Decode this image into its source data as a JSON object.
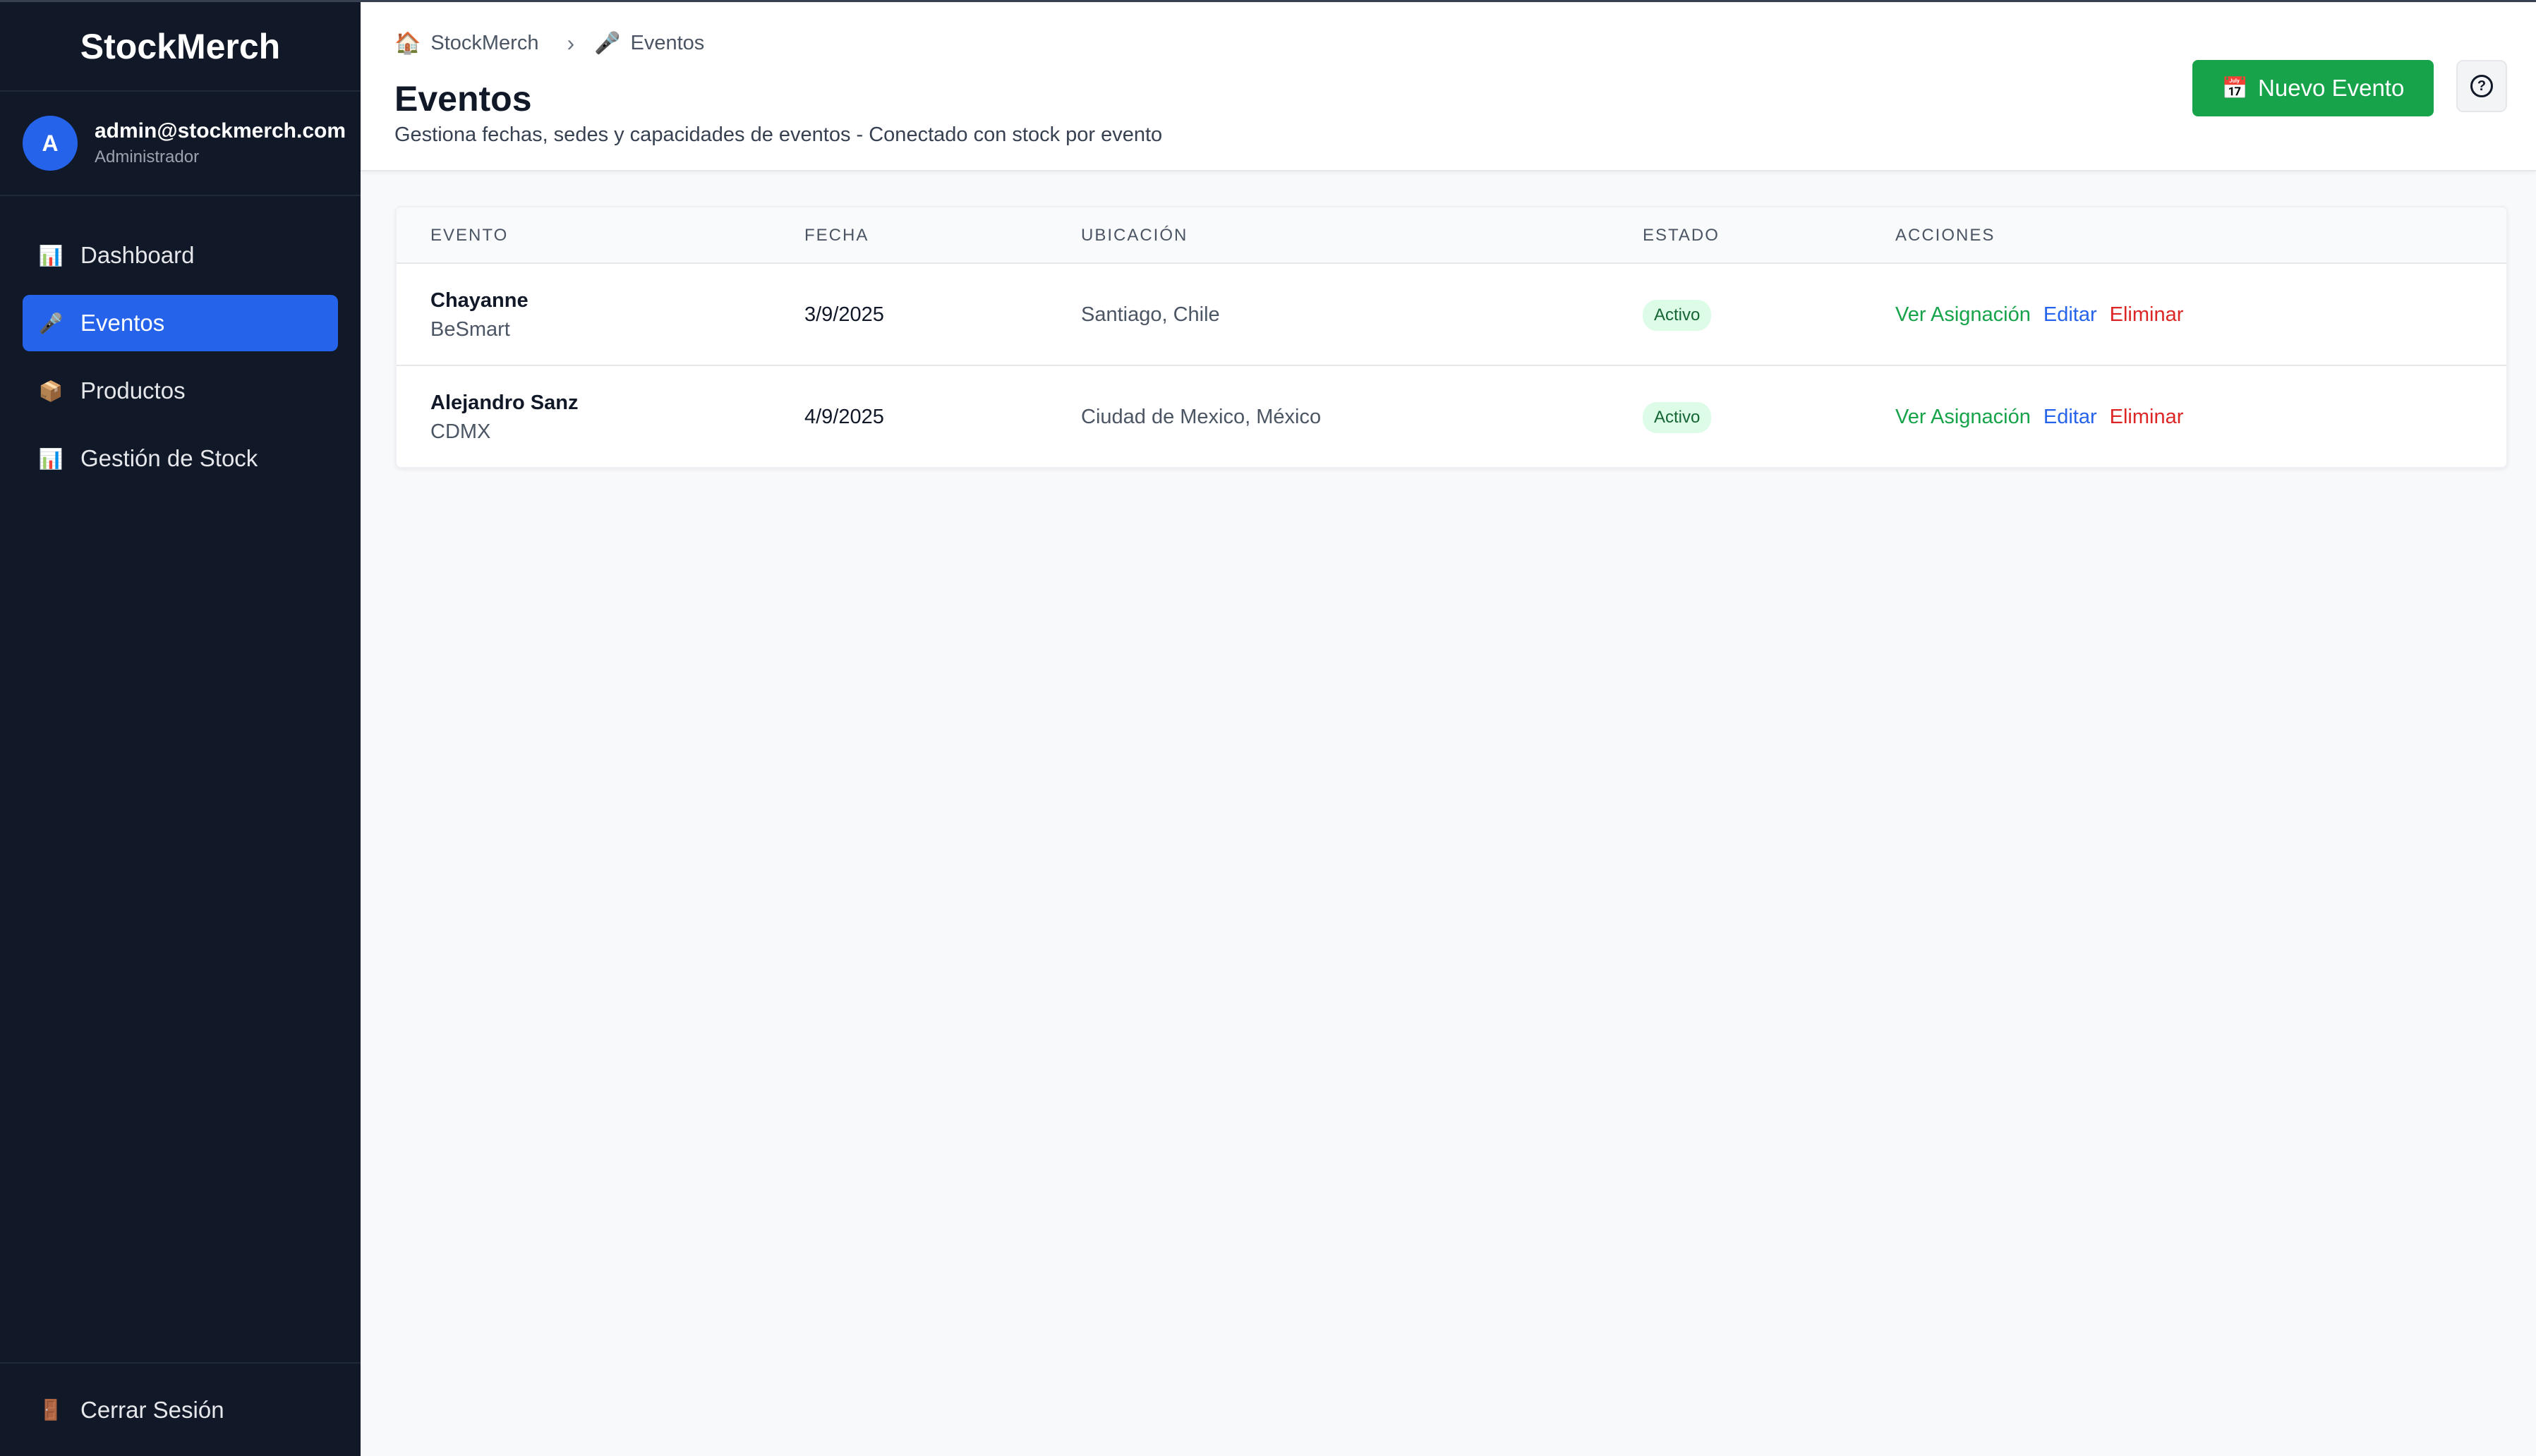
{
  "app": {
    "name": "StockMerch"
  },
  "user": {
    "initial": "A",
    "email": "admin@stockmerch.com",
    "role": "Administrador"
  },
  "sidebar": {
    "items": [
      {
        "label": "Dashboard",
        "icon": "📊",
        "icon_name": "chart-icon"
      },
      {
        "label": "Eventos",
        "icon": "🎤",
        "icon_name": "microphone-icon",
        "active": true
      },
      {
        "label": "Productos",
        "icon": "📦",
        "icon_name": "package-icon"
      },
      {
        "label": "Gestión de Stock",
        "icon": "📊",
        "icon_name": "chart-icon"
      }
    ],
    "logout": {
      "label": "Cerrar Sesión",
      "icon": "🚪",
      "icon_name": "door-icon"
    }
  },
  "breadcrumb": [
    {
      "label": "StockMerch",
      "icon": "🏠",
      "icon_name": "home-icon"
    },
    {
      "label": "Eventos",
      "icon": "🎤",
      "icon_name": "microphone-icon"
    }
  ],
  "breadcrumb_separator": "›",
  "header": {
    "title": "Eventos",
    "subtitle": "Gestiona fechas, sedes y capacidades de eventos - Conectado con stock por evento",
    "new_button": {
      "label": "Nuevo Evento",
      "icon": "📅",
      "icon_name": "calendar-icon"
    },
    "help_button": {
      "icon": "?",
      "icon_name": "help-icon"
    }
  },
  "table": {
    "columns": [
      "EVENTO",
      "FECHA",
      "UBICACIÓN",
      "ESTADO",
      "ACCIONES"
    ],
    "rows": [
      {
        "name": "Chayanne",
        "venue": "BeSmart",
        "date": "3/9/2025",
        "location": "Santiago, Chile",
        "status": "Activo"
      },
      {
        "name": "Alejandro Sanz",
        "venue": "CDMX",
        "date": "4/9/2025",
        "location": "Ciudad de Mexico, México",
        "status": "Activo"
      }
    ],
    "actions": {
      "view": "Ver Asignación",
      "edit": "Editar",
      "delete": "Eliminar"
    }
  },
  "colors": {
    "sidebar_bg": "#111827",
    "accent_blue": "#2563eb",
    "accent_green": "#16a34a",
    "danger_red": "#dc2626"
  }
}
